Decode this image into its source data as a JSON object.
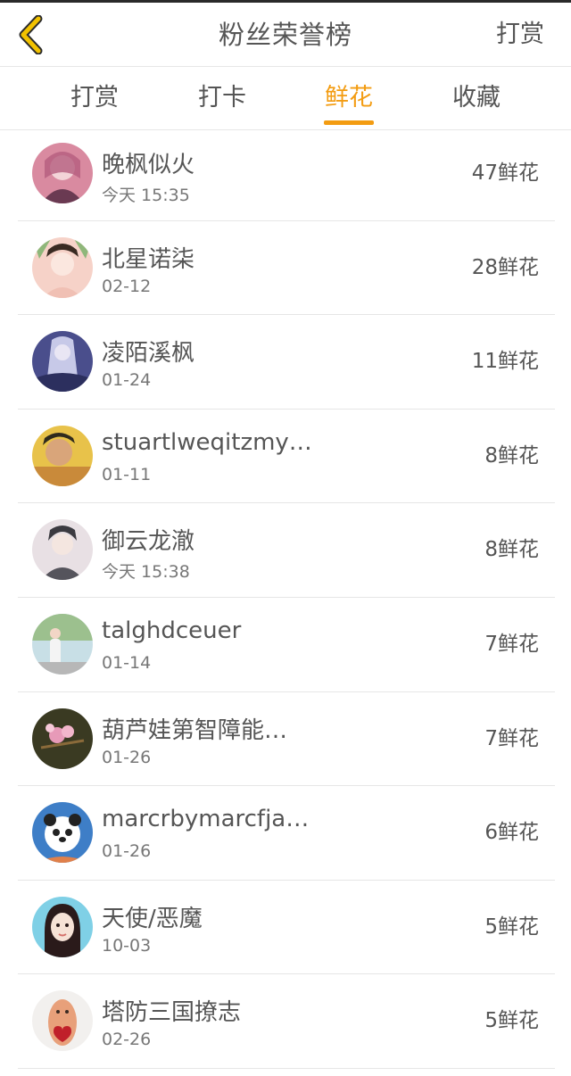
{
  "header": {
    "title": "粉丝荣誉榜",
    "action_label": "打赏"
  },
  "tabs": [
    {
      "label": "打赏"
    },
    {
      "label": "打卡"
    },
    {
      "label": "鲜花",
      "active": true
    },
    {
      "label": "收藏"
    }
  ],
  "list": [
    {
      "name": "晚枫似火",
      "time": "今天 15:35",
      "count": "47鲜花",
      "avatar_colors": [
        "#d98aa0",
        "#6a3a52"
      ]
    },
    {
      "name": "北星诺柒",
      "time": "02-12",
      "count": "28鲜花",
      "avatar_colors": [
        "#f6d2c8",
        "#8fb77a"
      ]
    },
    {
      "name": "凌陌溪枫",
      "time": "01-24",
      "count": "11鲜花",
      "avatar_colors": [
        "#4a4e8c",
        "#c7c9e8"
      ]
    },
    {
      "name": "stuartlweqitzmy…",
      "time": "01-11",
      "count": "8鲜花",
      "avatar_colors": [
        "#e8c24a",
        "#2f2a1d"
      ]
    },
    {
      "name": "御云龙澈",
      "time": "今天 15:38",
      "count": "8鲜花",
      "avatar_colors": [
        "#e8e0e4",
        "#3b3a40"
      ]
    },
    {
      "name": "talghdceuer",
      "time": "01-14",
      "count": "7鲜花",
      "avatar_colors": [
        "#c8dfe6",
        "#5d7a55"
      ]
    },
    {
      "name": "葫芦娃第智障能…",
      "time": "01-26",
      "count": "7鲜花",
      "avatar_colors": [
        "#3a3a22",
        "#e79ab8"
      ]
    },
    {
      "name": "marcrbymarcfja…",
      "time": "01-26",
      "count": "6鲜花",
      "avatar_colors": [
        "#3e7ec7",
        "#ffffff"
      ]
    },
    {
      "name": "天使/恶魔",
      "time": "10-03",
      "count": "5鲜花",
      "avatar_colors": [
        "#7fd0e6",
        "#2a1a1a"
      ]
    },
    {
      "name": "塔防三国撩志",
      "time": "02-26",
      "count": "5鲜花",
      "avatar_colors": [
        "#f2f0ee",
        "#e8a07a"
      ]
    }
  ],
  "colors": {
    "accent": "#f39c12",
    "back_icon": "#f2c200",
    "text": "#555555",
    "divider": "#e6e6e6"
  },
  "icons": {
    "back": "chevron-left-icon"
  }
}
